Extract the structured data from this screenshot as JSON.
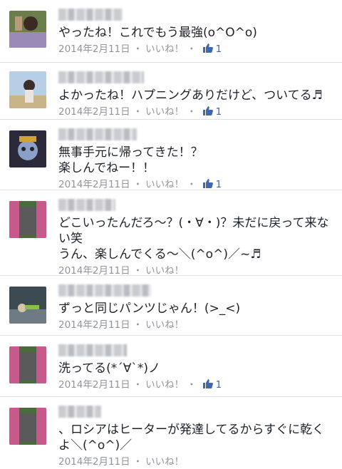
{
  "comments": [
    {
      "text": "やったね！これでもう最強(o^O^o)",
      "date": "2014年2月11日",
      "like_label": "いいね！",
      "like_count": "1"
    },
    {
      "text": "よかったね！ハプニングありだけど、ついてる♬",
      "date": "2014年2月11日",
      "like_label": "いいね！",
      "like_count": "1"
    },
    {
      "text": "無事手元に帰ってきた！？\n楽しんでねー！！",
      "date": "2014年2月11日",
      "like_label": "いいね！",
      "like_count": "1"
    },
    {
      "text": "どこいったんだろ〜？(・∀・)？未だに戻って来ない笑\nうん、楽しんでくる〜＼(^o^)／~♬",
      "date": "2014年2月11日",
      "like_label": "いいね！",
      "like_count": ""
    },
    {
      "text": "ずっと同じパンツじゃん！(>_<)",
      "date": "2014年2月11日",
      "like_label": "いいね！",
      "like_count": ""
    },
    {
      "text": "洗ってる(*´∀`*)ノ",
      "date": "2014年2月11日",
      "like_label": "いいね！",
      "like_count": "1"
    },
    {
      "text": "、ロシアはヒーターが発達してるからすぐに乾くよ＼(^o^)／",
      "date": "2014年2月11日",
      "like_label": "いいね！",
      "like_count": ""
    }
  ],
  "colors": {
    "text": "#1d2129",
    "meta": "#90949c",
    "link": "#4267b2",
    "divider": "#dddfe2"
  },
  "icons": {
    "like": "thumbs-up-icon"
  }
}
